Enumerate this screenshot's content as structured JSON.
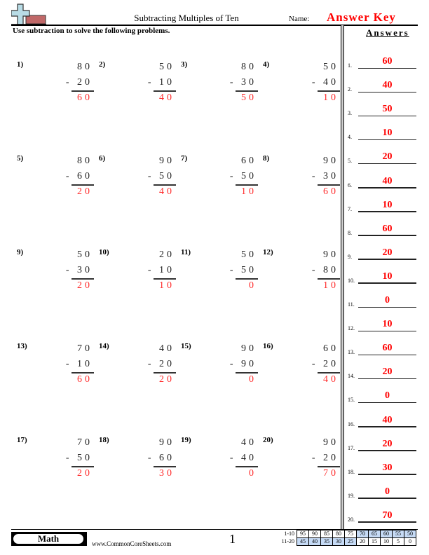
{
  "header": {
    "title": "Subtracting Multiples of Ten",
    "name_label": "Name:",
    "name_value": "Answer Key",
    "instructions": "Use subtraction to solve the following problems."
  },
  "problems": [
    {
      "label": "1)",
      "top": "80",
      "bottom": "- 20",
      "answer": "60"
    },
    {
      "label": "2)",
      "top": "50",
      "bottom": "- 10",
      "answer": "40"
    },
    {
      "label": "3)",
      "top": "80",
      "bottom": "- 30",
      "answer": "50"
    },
    {
      "label": "4)",
      "top": "50",
      "bottom": "- 40",
      "answer": "10"
    },
    {
      "label": "5)",
      "top": "80",
      "bottom": "- 60",
      "answer": "20"
    },
    {
      "label": "6)",
      "top": "90",
      "bottom": "- 50",
      "answer": "40"
    },
    {
      "label": "7)",
      "top": "60",
      "bottom": "- 50",
      "answer": "10"
    },
    {
      "label": "8)",
      "top": "90",
      "bottom": "- 30",
      "answer": "60"
    },
    {
      "label": "9)",
      "top": "50",
      "bottom": "- 30",
      "answer": "20"
    },
    {
      "label": "10)",
      "top": "20",
      "bottom": "- 10",
      "answer": "10"
    },
    {
      "label": "11)",
      "top": "50",
      "bottom": "- 50",
      "answer": "0"
    },
    {
      "label": "12)",
      "top": "90",
      "bottom": "- 80",
      "answer": "10"
    },
    {
      "label": "13)",
      "top": "70",
      "bottom": "- 10",
      "answer": "60"
    },
    {
      "label": "14)",
      "top": "40",
      "bottom": "- 20",
      "answer": "20"
    },
    {
      "label": "15)",
      "top": "90",
      "bottom": "- 90",
      "answer": "0"
    },
    {
      "label": "16)",
      "top": "60",
      "bottom": "- 20",
      "answer": "40"
    },
    {
      "label": "17)",
      "top": "70",
      "bottom": "- 50",
      "answer": "20"
    },
    {
      "label": "18)",
      "top": "90",
      "bottom": "- 60",
      "answer": "30"
    },
    {
      "label": "19)",
      "top": "40",
      "bottom": "- 40",
      "answer": "0"
    },
    {
      "label": "20)",
      "top": "90",
      "bottom": "- 20",
      "answer": "70"
    }
  ],
  "answers": {
    "title": "Answers",
    "items": [
      {
        "num": "1.",
        "value": "60"
      },
      {
        "num": "2.",
        "value": "40"
      },
      {
        "num": "3.",
        "value": "50"
      },
      {
        "num": "4.",
        "value": "10"
      },
      {
        "num": "5.",
        "value": "20"
      },
      {
        "num": "6.",
        "value": "40"
      },
      {
        "num": "7.",
        "value": "10"
      },
      {
        "num": "8.",
        "value": "60"
      },
      {
        "num": "9.",
        "value": "20"
      },
      {
        "num": "10.",
        "value": "10"
      },
      {
        "num": "11.",
        "value": "0"
      },
      {
        "num": "12.",
        "value": "10"
      },
      {
        "num": "13.",
        "value": "60"
      },
      {
        "num": "14.",
        "value": "20"
      },
      {
        "num": "15.",
        "value": "0"
      },
      {
        "num": "16.",
        "value": "40"
      },
      {
        "num": "17.",
        "value": "20"
      },
      {
        "num": "18.",
        "value": "30"
      },
      {
        "num": "19.",
        "value": "0"
      },
      {
        "num": "20.",
        "value": "70"
      }
    ]
  },
  "footer": {
    "subject": "Math",
    "site": "www.CommonCoreSheets.com",
    "page": "1",
    "score_table": {
      "rows": [
        {
          "label": "1-10",
          "cells": [
            "95",
            "90",
            "85",
            "80",
            "75",
            "70",
            "65",
            "60",
            "55",
            "50"
          ],
          "highlighted": [
            false,
            false,
            false,
            false,
            false,
            true,
            true,
            true,
            true,
            true
          ]
        },
        {
          "label": "11-20",
          "cells": [
            "45",
            "40",
            "35",
            "30",
            "25",
            "20",
            "15",
            "10",
            "5",
            "0"
          ],
          "highlighted": [
            true,
            true,
            true,
            true,
            true,
            false,
            false,
            false,
            false,
            false
          ]
        }
      ],
      "highlight_color": "#c6dbf6"
    }
  },
  "colors": {
    "answer_red": "#ff0000",
    "logo_cross": "#add8e6",
    "logo_bar": "#b05a5a"
  }
}
